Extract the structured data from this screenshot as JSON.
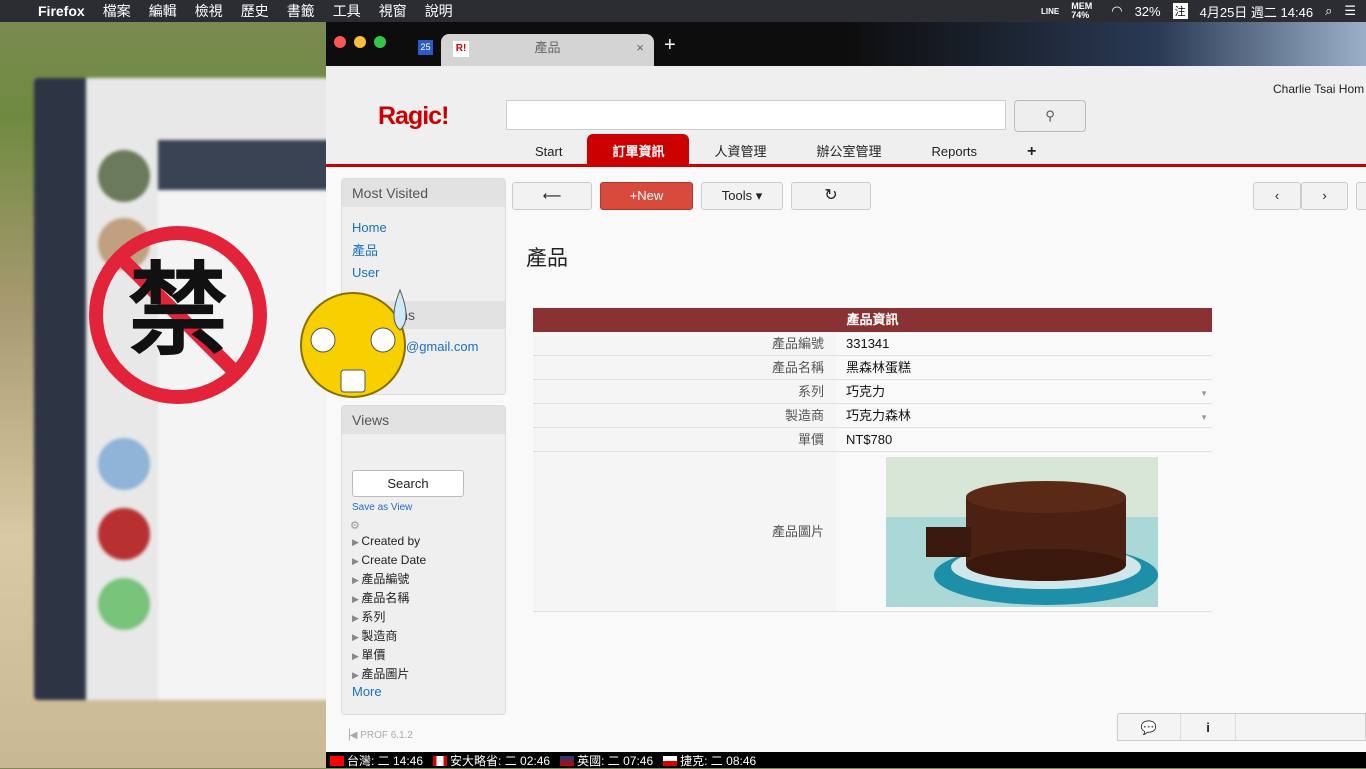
{
  "menubar": {
    "items": [
      "Firefox",
      "檔案",
      "編輯",
      "檢視",
      "歷史",
      "書籤",
      "工具",
      "視窗",
      "說明"
    ],
    "status": {
      "line": "LINE",
      "mem": "MEM 74%",
      "battery": "32%",
      "ime": "注",
      "datetime": "4月25日 週二 14:46"
    }
  },
  "browser": {
    "tab_title": "產品",
    "pinned_tab": "25",
    "new_tab": "+",
    "close": "×"
  },
  "header": {
    "logo": "Ragic!",
    "user": "Charlie Tsai Hom",
    "search_value": "",
    "nav": [
      "Start",
      "訂單資訊",
      "人資管理",
      "辦公室管理",
      "Reports",
      "+"
    ],
    "active_nav": "訂單資訊",
    "accent": "#cc0000"
  },
  "sidebar": {
    "most_visited_title": "Most Visited",
    "most_visited": [
      "Home",
      "產品",
      "User"
    ],
    "recent_title_fragment": "t Items",
    "recent_fragment": "@gmail.com",
    "views_title": "Views",
    "search_button": "Search",
    "save_as_view": "Save as View",
    "filters": [
      "Created by",
      "Create Date",
      "產品編號",
      "產品名稱",
      "系列",
      "製造商",
      "單價",
      "產品圖片"
    ],
    "more": "More",
    "version": "PROF 6.1.2"
  },
  "toolbar": {
    "back": "⟵",
    "new": "+New",
    "tools": "Tools ▾",
    "refresh": "↻",
    "prev": "‹",
    "next": "›"
  },
  "page_title": "產品",
  "form": {
    "section": "產品資訊",
    "section_color": "#8a3233",
    "fields": [
      {
        "label": "產品編號",
        "value": "331341"
      },
      {
        "label": "產品名稱",
        "value": "黑森林蛋糕"
      },
      {
        "label": "系列",
        "value": "巧克力",
        "dropdown": true
      },
      {
        "label": "製造商",
        "value": "巧克力森林",
        "dropdown": true
      },
      {
        "label": "單價",
        "value": "NT$780"
      }
    ],
    "image_label": "產品圖片"
  },
  "clocks": [
    "台灣: 二 14:46",
    "安大略省: 二 02:46",
    "英國: 二 07:46",
    "捷克: 二 08:46"
  ],
  "sticker_text": "禁"
}
